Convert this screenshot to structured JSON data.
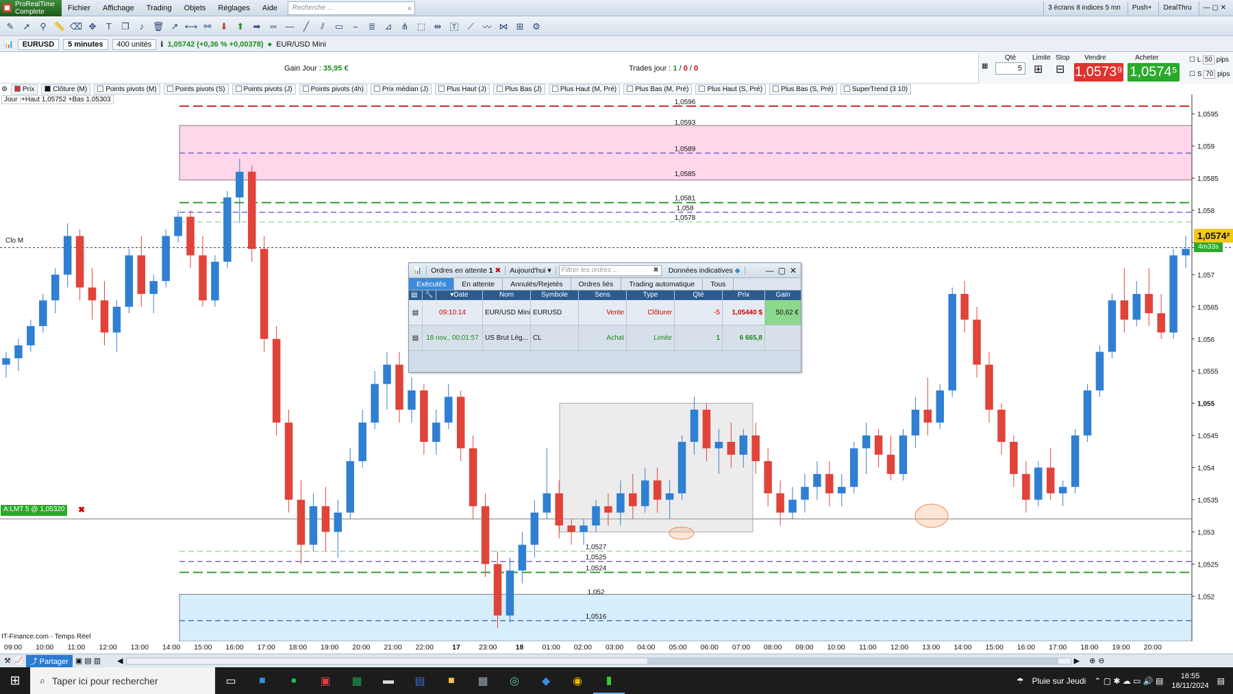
{
  "app": {
    "logo_line1": "ProRealTime",
    "logo_line2": "Complete"
  },
  "menu": [
    "Fichier",
    "Affichage",
    "Trading",
    "Objets",
    "Réglages",
    "Aide"
  ],
  "search": {
    "placeholder": "Recherche ..."
  },
  "menu_right": {
    "screens": "3 écrans 8 indices 5 mn",
    "push": "Push+",
    "dealthru": "DealThru"
  },
  "instrument": {
    "symbol": "EURUSD",
    "period": "5 minutes",
    "units": "400 unités",
    "price_info": "1,05742 (+0,36 % +0,00378)",
    "name": "EUR/USD Mini"
  },
  "gain": {
    "label": "Gain Jour :",
    "value": "35,95 €"
  },
  "trades": {
    "label": "Trades jour :",
    "v1": "1",
    "v2": "0",
    "v3": "0"
  },
  "order_panel": {
    "qte_label": "Qté",
    "qte_value": "5",
    "limite_label": "Limite",
    "stop_label": "Stop",
    "vendre_label": "Vendre",
    "acheter_label": "Acheter",
    "sell_price": "1,0573⁹",
    "buy_price": "1,0574⁵",
    "l_label": "L",
    "l_value": "50",
    "s_label": "S",
    "s_value": "70",
    "pips": "pips"
  },
  "indicators": [
    "Prix",
    "Clôture (M)",
    "Points pivots (M)",
    "Points pivots (S)",
    "Points pivots (J)",
    "Points pivots (4h)",
    "Prix médian (J)",
    "Plus Haut (J)",
    "Plus Bas (J)",
    "Plus Haut (M, Pré)",
    "Plus Bas (M, Pré)",
    "Plus Haut (S, Pré)",
    "Plus Bas (S, Pré)",
    "SuperTrend (3 10)"
  ],
  "jour_info": "Jour :+Haut 1,05752 +Bas 1,05303",
  "clo_label": "Clo M",
  "alert_tag": "A:LMT 5 @ 1,05320",
  "current": {
    "price": "1,0574²",
    "countdown": "4m33s"
  },
  "source": "IT-Finance.com - Temps Réel",
  "share_label": "Partager",
  "chart_data": {
    "type": "candlestick",
    "symbol": "EURUSD",
    "ylim": [
      1.0513,
      1.0598
    ],
    "y_ticks": [
      "1,0595",
      "1,059",
      "1,0585",
      "1,058",
      "1,0575",
      "1,057",
      "1,0565",
      "1,056",
      "1,0555",
      "1,055",
      "1,0545",
      "1,054",
      "1,0535",
      "1,053",
      "1,0525",
      "1,052"
    ],
    "x_ticks": [
      {
        "label": "09:00",
        "bold": false
      },
      {
        "label": "10:00",
        "bold": false
      },
      {
        "label": "11:00",
        "bold": false
      },
      {
        "label": "12:00",
        "bold": false
      },
      {
        "label": "13:00",
        "bold": false
      },
      {
        "label": "14:00",
        "bold": false
      },
      {
        "label": "15:00",
        "bold": false
      },
      {
        "label": "16:00",
        "bold": false
      },
      {
        "label": "17:00",
        "bold": false
      },
      {
        "label": "18:00",
        "bold": false
      },
      {
        "label": "19:00",
        "bold": false
      },
      {
        "label": "20:00",
        "bold": false
      },
      {
        "label": "21:00",
        "bold": false
      },
      {
        "label": "22:00",
        "bold": false
      },
      {
        "label": "17",
        "bold": true
      },
      {
        "label": "23:00",
        "bold": false
      },
      {
        "label": "18",
        "bold": true
      },
      {
        "label": "01:00",
        "bold": false
      },
      {
        "label": "02:00",
        "bold": false
      },
      {
        "label": "03:00",
        "bold": false
      },
      {
        "label": "04:00",
        "bold": false
      },
      {
        "label": "05:00",
        "bold": false
      },
      {
        "label": "06:00",
        "bold": false
      },
      {
        "label": "07:00",
        "bold": false
      },
      {
        "label": "08:00",
        "bold": false
      },
      {
        "label": "09:00",
        "bold": false
      },
      {
        "label": "10:00",
        "bold": false
      },
      {
        "label": "11:00",
        "bold": false
      },
      {
        "label": "12:00",
        "bold": false
      },
      {
        "label": "13:00",
        "bold": false
      },
      {
        "label": "14:00",
        "bold": false
      },
      {
        "label": "15:00",
        "bold": false
      },
      {
        "label": "16:00",
        "bold": false
      },
      {
        "label": "17:00",
        "bold": false
      },
      {
        "label": "18:00",
        "bold": false
      },
      {
        "label": "19:00",
        "bold": false
      },
      {
        "label": "20:00",
        "bold": false
      }
    ],
    "levels": [
      {
        "value": 1.05962,
        "label": "1,0596",
        "color": "#c62828",
        "dash": "14,6",
        "w": 2
      },
      {
        "value": 1.05889,
        "label": "1,0589",
        "color": "#5e5bd6",
        "dash": "8,5",
        "w": 1.3
      },
      {
        "value": 1.05812,
        "label": "1,0581",
        "color": "#2e9e2e",
        "dash": "14,6",
        "w": 2
      },
      {
        "value": 1.05797,
        "label": "1,058",
        "color": "#5e5bd6",
        "dash": "8,5",
        "w": 1.3
      },
      {
        "value": 1.05782,
        "label": "1,0578",
        "color": "#7fc07f",
        "dash": "8,5",
        "w": 1
      },
      {
        "value": 1.0527,
        "label": "1,0527",
        "color": "#7fc07f",
        "dash": "8,5",
        "w": 1
      },
      {
        "value": 1.05254,
        "label": "1,0525",
        "color": "#5e5bd6",
        "dash": "8,5",
        "w": 1.3
      },
      {
        "value": 1.05237,
        "label": "1,0524",
        "color": "#2e9e2e",
        "dash": "14,6",
        "w": 2
      },
      {
        "value": 1.05162,
        "label": "1,0516",
        "color": "#1f4fa0",
        "dash": "8,5",
        "w": 1.2
      }
    ],
    "zone_labels": [
      {
        "value": 1.0593,
        "label": "1,0593"
      },
      {
        "value": 1.0585,
        "label": "1,0585"
      },
      {
        "value": 1.052,
        "label": "1,052"
      }
    ],
    "zones": [
      {
        "from": 1.05847,
        "to": 1.05932,
        "color": "#ffd6ea"
      },
      {
        "from": 1.0513,
        "to": 1.05203,
        "color": "#d7eefc"
      }
    ],
    "close_level": 1.05742,
    "alert_level": 1.0532,
    "candles": [
      [
        1.0556,
        1.0558,
        1.0554,
        1.0557
      ],
      [
        1.0557,
        1.056,
        1.0555,
        1.0559
      ],
      [
        1.0559,
        1.0563,
        1.0558,
        1.0562
      ],
      [
        1.0562,
        1.0567,
        1.0561,
        1.0566
      ],
      [
        1.0566,
        1.0571,
        1.0564,
        1.057
      ],
      [
        1.057,
        1.0578,
        1.0568,
        1.0576
      ],
      [
        1.0576,
        1.0577,
        1.0566,
        1.0568
      ],
      [
        1.0568,
        1.0571,
        1.0563,
        1.0566
      ],
      [
        1.0566,
        1.0569,
        1.0559,
        1.0561
      ],
      [
        1.0561,
        1.0566,
        1.0558,
        1.0565
      ],
      [
        1.0565,
        1.0574,
        1.0564,
        1.0573
      ],
      [
        1.0573,
        1.0576,
        1.0565,
        1.0567
      ],
      [
        1.0567,
        1.057,
        1.0564,
        1.0569
      ],
      [
        1.0569,
        1.0577,
        1.0568,
        1.0576
      ],
      [
        1.0576,
        1.058,
        1.0575,
        1.0579
      ],
      [
        1.0579,
        1.058,
        1.0571,
        1.0573
      ],
      [
        1.0573,
        1.0576,
        1.0565,
        1.0566
      ],
      [
        1.0566,
        1.0573,
        1.0565,
        1.0572
      ],
      [
        1.0572,
        1.0583,
        1.0571,
        1.0582
      ],
      [
        1.0582,
        1.0588,
        1.0578,
        1.0586
      ],
      [
        1.0586,
        1.0587,
        1.0572,
        1.0574
      ],
      [
        1.0574,
        1.0576,
        1.0558,
        1.056
      ],
      [
        1.056,
        1.0562,
        1.0545,
        1.0547
      ],
      [
        1.0547,
        1.0549,
        1.0533,
        1.0535
      ],
      [
        1.0535,
        1.0538,
        1.0525,
        1.0528
      ],
      [
        1.0528,
        1.0536,
        1.0527,
        1.0534
      ],
      [
        1.0534,
        1.0537,
        1.0527,
        1.053
      ],
      [
        1.053,
        1.0535,
        1.0526,
        1.0533
      ],
      [
        1.0533,
        1.0543,
        1.0532,
        1.0541
      ],
      [
        1.0541,
        1.0549,
        1.054,
        1.0547
      ],
      [
        1.0547,
        1.0555,
        1.0546,
        1.0553
      ],
      [
        1.0553,
        1.0558,
        1.0549,
        1.0556
      ],
      [
        1.0556,
        1.0558,
        1.0547,
        1.0549
      ],
      [
        1.0549,
        1.0554,
        1.0547,
        1.0552
      ],
      [
        1.0552,
        1.0553,
        1.0542,
        1.0544
      ],
      [
        1.0544,
        1.0549,
        1.0542,
        1.0547
      ],
      [
        1.0547,
        1.0553,
        1.0546,
        1.0551
      ],
      [
        1.0551,
        1.0552,
        1.0541,
        1.0543
      ],
      [
        1.0543,
        1.0545,
        1.0532,
        1.0534
      ],
      [
        1.0534,
        1.0536,
        1.0523,
        1.0525
      ],
      [
        1.0525,
        1.0527,
        1.0515,
        1.0517
      ],
      [
        1.0517,
        1.0526,
        1.0516,
        1.0524
      ],
      [
        1.0524,
        1.053,
        1.0522,
        1.0528
      ],
      [
        1.0528,
        1.0535,
        1.0526,
        1.0533
      ],
      [
        1.0533,
        1.0543,
        1.0532,
        1.0536
      ],
      [
        1.0536,
        1.0538,
        1.0529,
        1.0531
      ],
      [
        1.0531,
        1.0532,
        1.0528,
        1.053
      ],
      [
        1.053,
        1.0532,
        1.0528,
        1.0531
      ],
      [
        1.0531,
        1.0535,
        1.053,
        1.0534
      ],
      [
        1.0534,
        1.0536,
        1.0531,
        1.0533
      ],
      [
        1.0533,
        1.0538,
        1.0531,
        1.0536
      ],
      [
        1.0536,
        1.0539,
        1.0532,
        1.0534
      ],
      [
        1.0534,
        1.054,
        1.0533,
        1.0538
      ],
      [
        1.0538,
        1.054,
        1.0533,
        1.0535
      ],
      [
        1.0535,
        1.0538,
        1.0532,
        1.0536
      ],
      [
        1.0536,
        1.0545,
        1.0535,
        1.0544
      ],
      [
        1.0544,
        1.0551,
        1.0542,
        1.0549
      ],
      [
        1.0549,
        1.055,
        1.0541,
        1.0543
      ],
      [
        1.0543,
        1.0546,
        1.0539,
        1.0544
      ],
      [
        1.0544,
        1.0547,
        1.054,
        1.0542
      ],
      [
        1.0542,
        1.0546,
        1.054,
        1.0545
      ],
      [
        1.0545,
        1.0547,
        1.0539,
        1.0541
      ],
      [
        1.0541,
        1.0543,
        1.0534,
        1.0536
      ],
      [
        1.0536,
        1.0538,
        1.0531,
        1.0533
      ],
      [
        1.0533,
        1.0537,
        1.0532,
        1.0535
      ],
      [
        1.0535,
        1.0539,
        1.0533,
        1.0537
      ],
      [
        1.0537,
        1.0541,
        1.0535,
        1.0539
      ],
      [
        1.0539,
        1.0541,
        1.0534,
        1.0536
      ],
      [
        1.0536,
        1.0539,
        1.0534,
        1.0537
      ],
      [
        1.0537,
        1.0544,
        1.0536,
        1.0543
      ],
      [
        1.0543,
        1.0547,
        1.0539,
        1.0545
      ],
      [
        1.0545,
        1.0546,
        1.054,
        1.0542
      ],
      [
        1.0542,
        1.0545,
        1.0538,
        1.0539
      ],
      [
        1.0539,
        1.0546,
        1.0538,
        1.0545
      ],
      [
        1.0545,
        1.0551,
        1.0543,
        1.0549
      ],
      [
        1.0549,
        1.0554,
        1.0545,
        1.0547
      ],
      [
        1.0547,
        1.0553,
        1.0546,
        1.0552
      ],
      [
        1.0552,
        1.0568,
        1.0551,
        1.0567
      ],
      [
        1.0567,
        1.0569,
        1.0561,
        1.0563
      ],
      [
        1.0563,
        1.0565,
        1.0554,
        1.0556
      ],
      [
        1.0556,
        1.0558,
        1.0547,
        1.0549
      ],
      [
        1.0549,
        1.055,
        1.0542,
        1.0544
      ],
      [
        1.0544,
        1.0545,
        1.0537,
        1.0539
      ],
      [
        1.0539,
        1.0541,
        1.0533,
        1.0535
      ],
      [
        1.0535,
        1.0541,
        1.0534,
        1.054
      ],
      [
        1.054,
        1.0543,
        1.0535,
        1.0536
      ],
      [
        1.0536,
        1.0538,
        1.0534,
        1.0537
      ],
      [
        1.0537,
        1.0546,
        1.0536,
        1.0545
      ],
      [
        1.0545,
        1.0553,
        1.0544,
        1.0552
      ],
      [
        1.0552,
        1.0559,
        1.0551,
        1.0558
      ],
      [
        1.0558,
        1.0567,
        1.0557,
        1.0566
      ],
      [
        1.0566,
        1.0571,
        1.0561,
        1.0563
      ],
      [
        1.0563,
        1.0569,
        1.0562,
        1.0567
      ],
      [
        1.0567,
        1.0571,
        1.0562,
        1.0564
      ],
      [
        1.0564,
        1.0567,
        1.056,
        1.0561
      ],
      [
        1.0561,
        1.0574,
        1.056,
        1.0573
      ],
      [
        1.0573,
        1.0576,
        1.0571,
        1.0574
      ]
    ]
  },
  "dialog": {
    "tab_label": "Ordres en attente",
    "tab_count": "1",
    "period": "Aujourd'hui",
    "filter_placeholder": "Filtrer les ordres ...",
    "info": "Données indicatives",
    "tabs": [
      "Exécutés",
      "En attente",
      "Annulés/Rejetés",
      "Ordres liés",
      "Trading automatique",
      "Tous"
    ],
    "columns": [
      "Date",
      "Nom",
      "Symbole",
      "Sens",
      "Type",
      "Qté",
      "Prix",
      "Gain"
    ],
    "rows": [
      {
        "date": "09:10:14",
        "nom": "EUR/USD Mini",
        "symbole": "EURUSD",
        "sens": "Vente",
        "type": "Clôturer",
        "qte": "-5",
        "prix": "1,05440 $",
        "gain": "50,62 €"
      },
      {
        "date": "18 nov., 00:01:57",
        "nom": "US Brut Lég...",
        "symbole": "CL",
        "sens": "Achat",
        "type": "Limite",
        "qte": "1",
        "prix": "6 665,8",
        "gain": ""
      }
    ]
  },
  "taskbar": {
    "search_placeholder": "Taper ici pour rechercher",
    "weather": "Pluie sur Jeudi",
    "time": "16:55",
    "date": "18/11/2024"
  }
}
